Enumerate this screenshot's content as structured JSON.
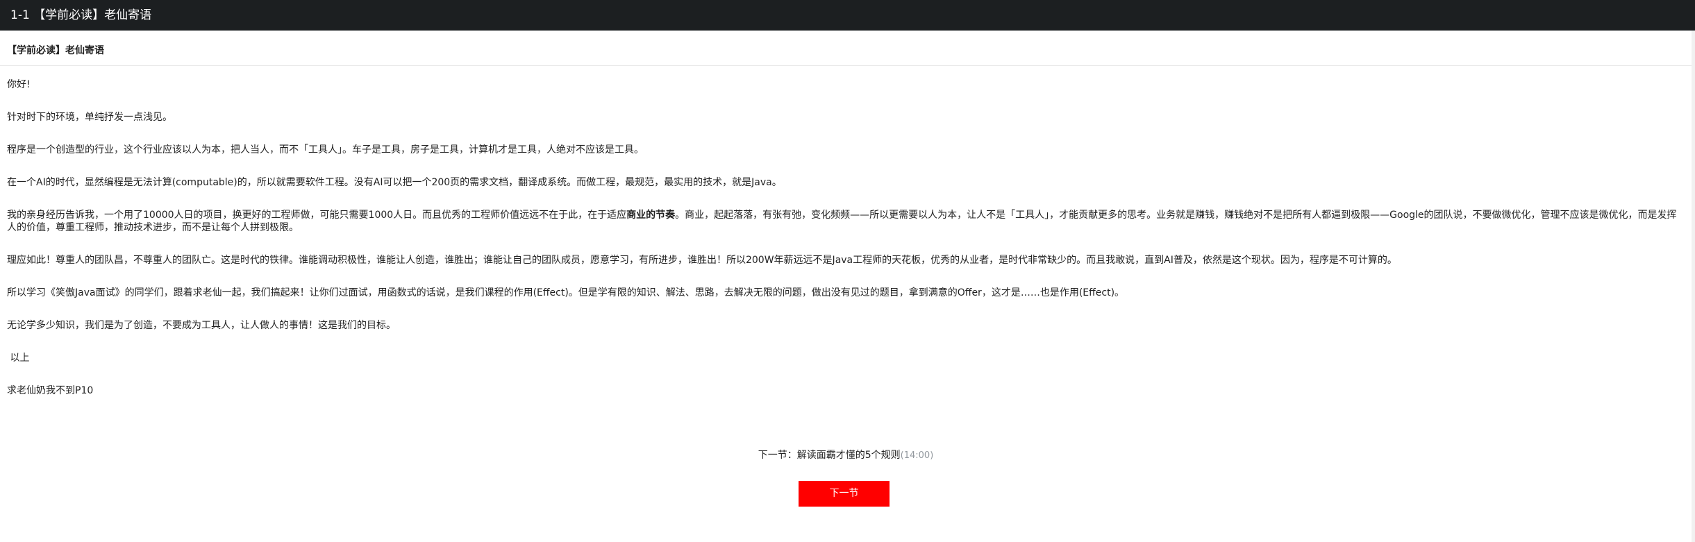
{
  "header": {
    "title": "1-1 【学前必读】老仙寄语"
  },
  "article": {
    "title": "【学前必读】老仙寄语",
    "paragraphs": {
      "p1": "你好!",
      "p2": "针对时下的环境，单纯抒发一点浅见。",
      "p3": "程序是一个创造型的行业，这个行业应该以人为本，把人当人，而不「工具人」。车子是工具，房子是工具，计算机才是工具，人绝对不应该是工具。",
      "p4": "在一个AI的时代，显然编程是无法计算(computable)的，所以就需要软件工程。没有AI可以把一个200页的需求文档，翻译成系统。而做工程，最规范，最实用的技术，就是Java。",
      "p5a": "我的亲身经历告诉我，一个用了10000人日的项目，换更好的工程师做，可能只需要1000人日。而且优秀的工程师价值远远不在于此，在于适应",
      "p5b": "商业的节奏",
      "p5c": "。商业，起起落落，有张有弛，变化频频——所以更需要以人为本，让人不是「工具人」，才能贡献更多的思考。业务就是赚钱，赚钱绝对不是把所有人都逼到极限——Google的团队说，不要做微优化，管理不应该是微优化，而是发挥人的价值，尊重工程师，推动技术进步，而不是让每个人拼到极限。",
      "p6": "理应如此！尊重人的团队昌，不尊重人的团队亡。这是时代的铁律。谁能调动积极性，谁能让人创造，谁胜出；谁能让自己的团队成员，愿意学习，有所进步，谁胜出！所以200W年薪远远不是Java工程师的天花板，优秀的从业者，是时代非常缺少的。而且我敢说，直到AI普及，依然是这个现状。因为，程序是不可计算的。",
      "p7": "所以学习《笑傲Java面试》的同学们，跟着求老仙一起，我们搞起来！让你们过面试，用函数式的话说，是我们课程的作用(Effect)。但是学有限的知识、解法、思路，去解决无限的问题，做出没有见过的题目，拿到满意的Offer，这才是……也是作用(Effect)。",
      "p8": "无论学多少知识，我们是为了创造，不要成为工具人，让人做人的事情！这是我们的目标。",
      "p9": " 以上",
      "p10": "求老仙奶我不到P10"
    }
  },
  "next": {
    "prefix": "下一节：解读面霸才懂的5个规则",
    "duration": "(14:00)",
    "button_label": "下一节",
    "button_color": "#ff0000"
  },
  "colors": {
    "header_bg": "#1c1f21",
    "text": "#222222",
    "muted": "#93999f"
  }
}
